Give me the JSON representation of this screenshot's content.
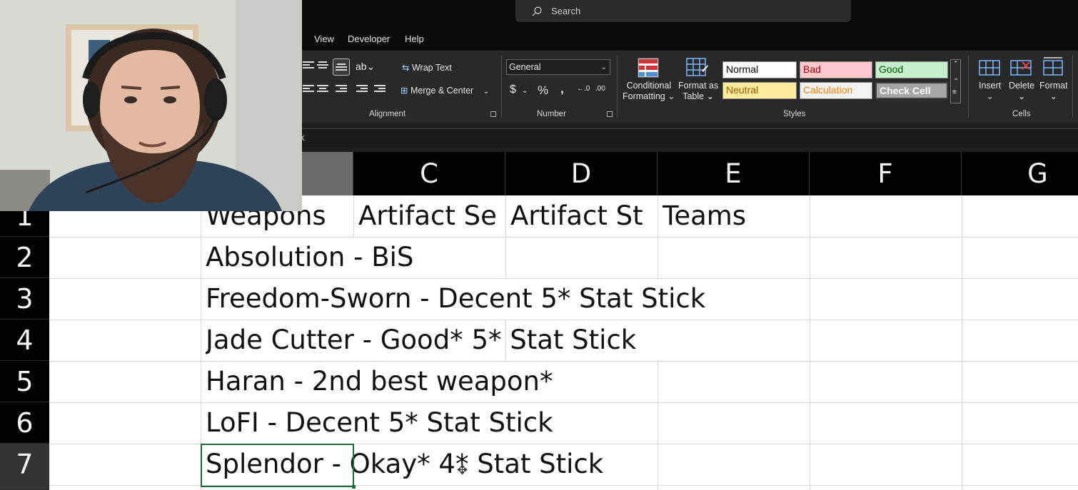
{
  "search": {
    "placeholder": "Search"
  },
  "menu": [
    "View",
    "Developer",
    "Help"
  ],
  "ribbon": {
    "alignment": {
      "wrap_text": "Wrap Text",
      "merge_center": "Merge & Center",
      "label": "Alignment"
    },
    "number": {
      "format": "General",
      "currency": "$",
      "percent": "%",
      "comma": ",",
      "label": "Number"
    },
    "styles": {
      "conditional_formatting": [
        "Conditional",
        "Formatting"
      ],
      "format_as_table": [
        "Format as",
        "Table"
      ],
      "cells": [
        {
          "name": "Normal",
          "bg": "#ffffff",
          "fg": "#000000"
        },
        {
          "name": "Bad",
          "bg": "#ffc7ce",
          "fg": "#9c0006"
        },
        {
          "name": "Good",
          "bg": "#c6efce",
          "fg": "#006100"
        },
        {
          "name": "Neutral",
          "bg": "#ffeb9c",
          "fg": "#9c5700"
        },
        {
          "name": "Calculation",
          "bg": "#f2f2f2",
          "fg": "#fa7d00"
        },
        {
          "name": "Check Cell",
          "bg": "#a5a5a5",
          "fg": "#ffffff"
        }
      ],
      "label": "Styles"
    },
    "cells": {
      "insert": "Insert",
      "delete": "Delete",
      "format": "Format",
      "label": "Cells"
    }
  },
  "formula_bar": {
    "content": "k"
  },
  "columns": [
    "C",
    "D",
    "E",
    "F",
    "G"
  ],
  "rows": [
    "1",
    "2",
    "3",
    "4",
    "5",
    "6",
    "7"
  ],
  "cells": {
    "B1": "Weapons",
    "C1": "Artifact Se",
    "D1": "Artifact St",
    "E1": "Teams",
    "B2": "Absolution - BiS",
    "B3": "Freedom-Sworn - Decent 5* Stat Stick",
    "B4": "Jade Cutter - Good* 5* Stat Stick",
    "B5": "Haran - 2nd best weapon*",
    "B6": "LoFI - Decent 5* Stat Stick",
    "B7": "Splendor - Okay* 4* Stat Stick"
  }
}
